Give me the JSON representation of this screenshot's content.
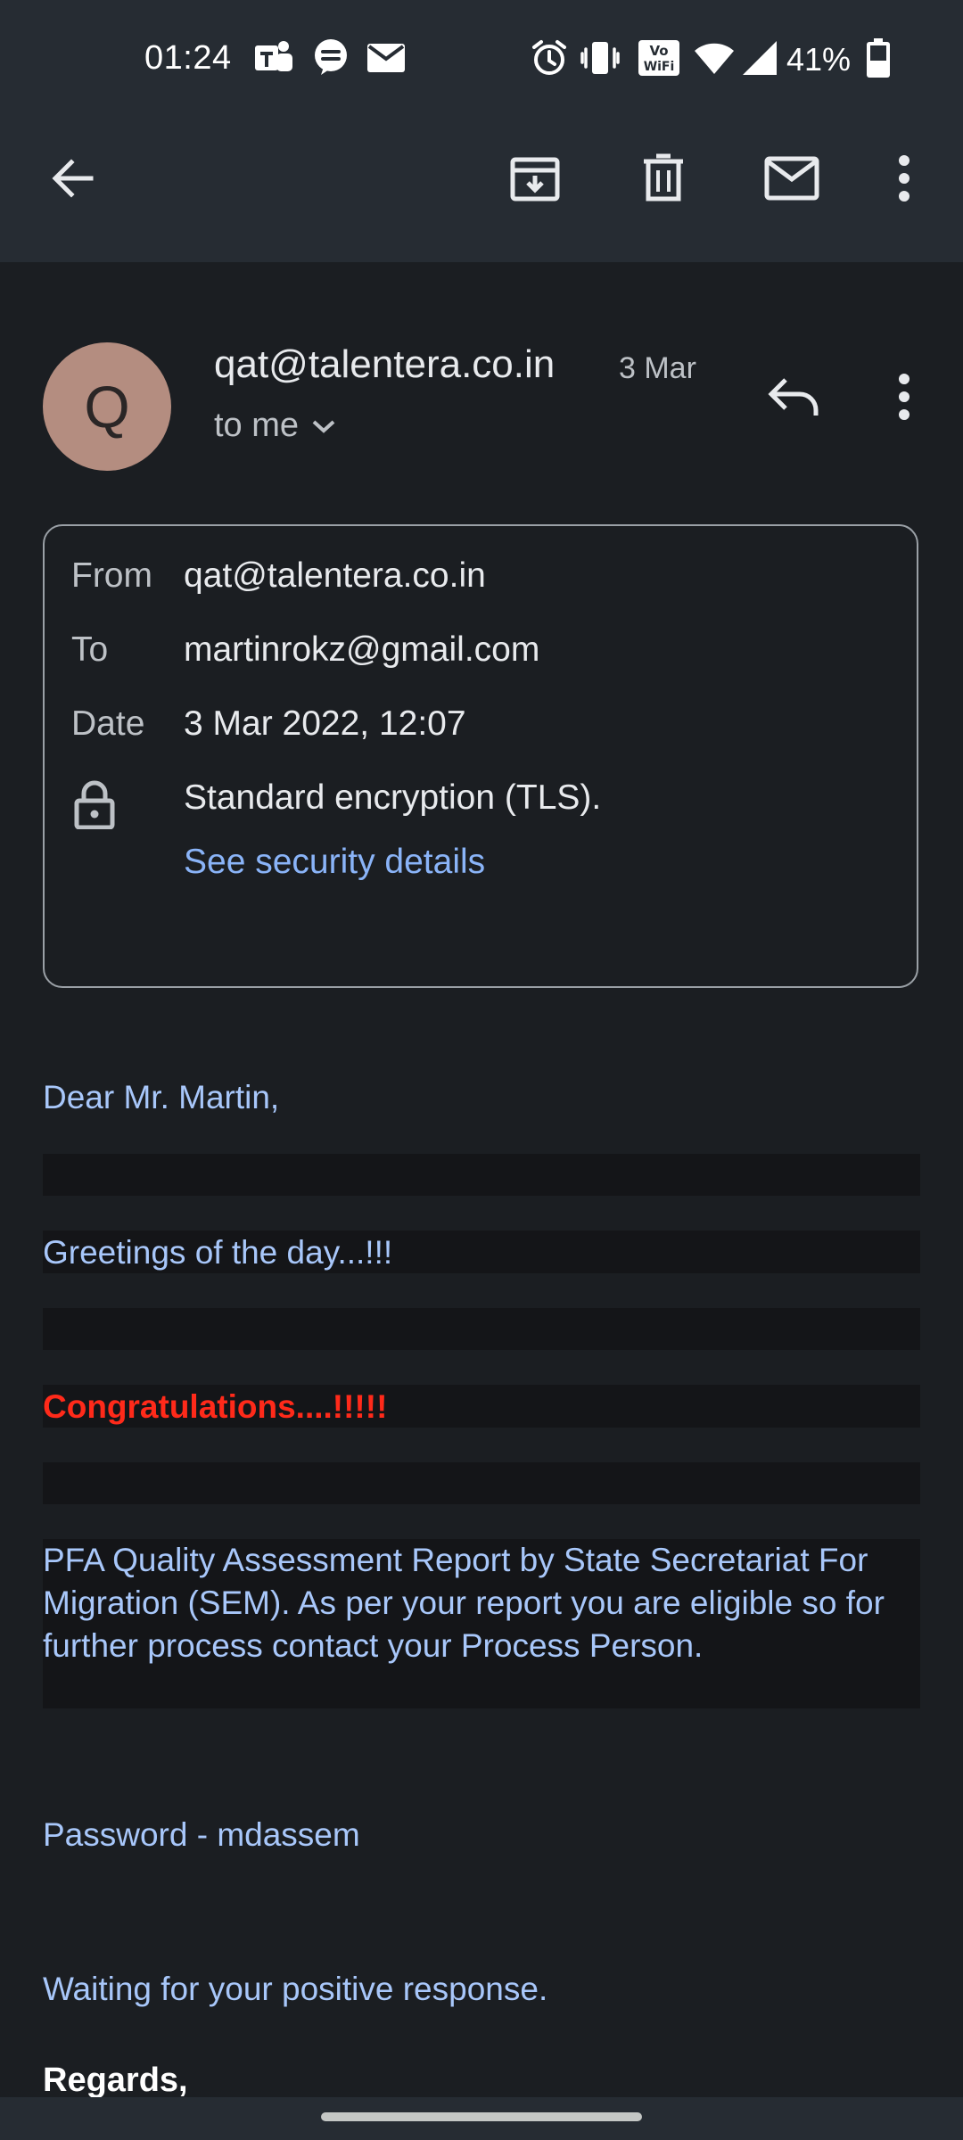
{
  "status_bar": {
    "time": "01:24",
    "battery_text": "41%",
    "notification_icons": [
      "teams-icon",
      "hush-icon",
      "mail-icon"
    ],
    "system_icons": [
      "alarm-icon",
      "vibrate-icon",
      "vowifi-icon",
      "wifi-icon",
      "signal-icon",
      "battery-icon"
    ]
  },
  "toolbar": {
    "back": "back-arrow-icon",
    "archive": "archive-icon",
    "delete": "delete-icon",
    "mark_unread": "mail-icon",
    "more": "more-vert-icon"
  },
  "header": {
    "avatar_letter": "Q",
    "avatar_color": "#b48d80",
    "sender": "qat@talentera.co.in",
    "date": "3 Mar",
    "recipient_summary": "to me"
  },
  "details": {
    "from_label": "From",
    "from_value": "qat@talentera.co.in",
    "to_label": "To",
    "to_value": "martinrokz@gmail.com",
    "date_label": "Date",
    "date_value": "3 Mar 2022, 12:07",
    "encryption": "Standard encryption (TLS).",
    "security_link": "See security details"
  },
  "body": {
    "greeting": "Dear Mr. Martin,",
    "line_greetings": "Greetings of the day...!!!",
    "line_congrats": "Congratulations....!!!!!",
    "paragraph": "PFA Quality Assessment Report by State Secretariat For Migration (SEM). As per your report you are eligible so for further process contact your Process Person.",
    "password": "Password - mdassem",
    "waiting": "Waiting for your positive response.",
    "regards": "Regards,"
  },
  "colors": {
    "background": "#1b1e22",
    "appbar": "#262c33",
    "body_text": "#a8c7fa",
    "link": "#8ab4f8",
    "congrats": "#ff2a1a"
  }
}
